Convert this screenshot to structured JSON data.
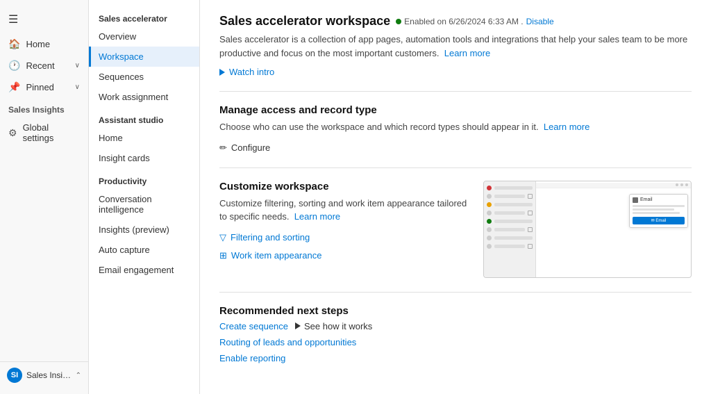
{
  "leftNav": {
    "hamburger": "☰",
    "items": [
      {
        "label": "Home",
        "icon": "🏠",
        "hasChevron": false
      },
      {
        "label": "Recent",
        "icon": "🕐",
        "hasChevron": true
      },
      {
        "label": "Pinned",
        "icon": "📌",
        "hasChevron": true
      }
    ],
    "sectionLabel": "Sales Insights",
    "globalSettings": "Global settings"
  },
  "userBar": {
    "initials": "SI",
    "label": "Sales Insights sett...",
    "chevron": "⌃"
  },
  "midNav": {
    "sections": [
      {
        "label": "Sales accelerator",
        "items": [
          {
            "label": "Overview",
            "active": false
          },
          {
            "label": "Workspace",
            "active": true
          },
          {
            "label": "Sequences",
            "active": false
          },
          {
            "label": "Work assignment",
            "active": false
          }
        ]
      },
      {
        "label": "Assistant studio",
        "items": [
          {
            "label": "Home",
            "active": false
          },
          {
            "label": "Insight cards",
            "active": false
          }
        ]
      },
      {
        "label": "Productivity",
        "items": [
          {
            "label": "Conversation intelligence",
            "active": false
          },
          {
            "label": "Insights (preview)",
            "active": false
          },
          {
            "label": "Auto capture",
            "active": false
          },
          {
            "label": "Email engagement",
            "active": false
          }
        ]
      }
    ]
  },
  "main": {
    "pageTitle": "Sales accelerator workspace",
    "enabledText": "Enabled on 6/26/2024 6:33 AM .",
    "disableLabel": "Disable",
    "description": "Sales accelerator is a collection of app pages, automation tools and integrations that help your sales team to be more productive and focus on the most important customers.",
    "learnMoreLabel": "Learn more",
    "watchIntroLabel": "Watch intro",
    "manageSection": {
      "title": "Manage access and record type",
      "description": "Choose who can use the workspace and which record types should appear in it.",
      "learnMoreLabel": "Learn more",
      "configureLabel": "Configure"
    },
    "customizeSection": {
      "title": "Customize workspace",
      "description": "Customize filtering, sorting and work item appearance tailored to specific needs.",
      "learnMoreLabel": "Learn more",
      "filteringLabel": "Filtering and sorting",
      "workItemLabel": "Work item appearance"
    },
    "recommendedSection": {
      "title": "Recommended next steps",
      "createSequenceLabel": "Create sequence",
      "seeHowLabel": "See how it works",
      "routingLabel": "Routing of leads and opportunities",
      "enableReportingLabel": "Enable reporting"
    }
  }
}
